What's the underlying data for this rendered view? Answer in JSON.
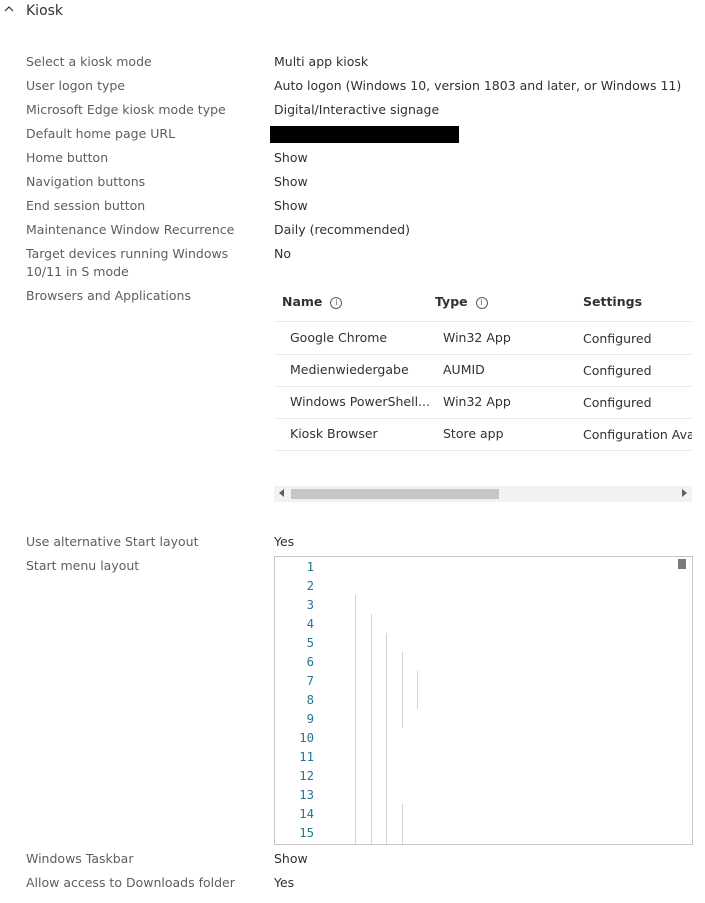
{
  "section": {
    "title": "Kiosk"
  },
  "fields": [
    {
      "label": "Select a kiosk mode",
      "value": "Multi app kiosk"
    },
    {
      "label": "User logon type",
      "value": "Auto logon (Windows 10, version 1803 and later, or Windows 11)"
    },
    {
      "label": "Microsoft Edge kiosk mode type",
      "value": "Digital/Interactive signage"
    },
    {
      "label": "Default home page URL",
      "value": ""
    },
    {
      "label": "Home button",
      "value": "Show"
    },
    {
      "label": "Navigation buttons",
      "value": "Show"
    },
    {
      "label": "End session button",
      "value": "Show"
    },
    {
      "label": "Maintenance Window Recurrence",
      "value": "Daily (recommended)"
    },
    {
      "label": "Target devices running Windows 10/11 in S mode",
      "value": "No"
    },
    {
      "label": "Browsers and Applications",
      "value": ""
    }
  ],
  "apps_table": {
    "headers": {
      "name": "Name",
      "type": "Type",
      "settings": "Settings"
    },
    "rows": [
      {
        "name": "Google Chrome",
        "type": "Win32 App",
        "settings": "Configured"
      },
      {
        "name": "Medienwiedergabe",
        "type": "AUMID",
        "settings": "Configured"
      },
      {
        "name": "Windows PowerShell...",
        "type": "Win32 App",
        "settings": "Configured"
      },
      {
        "name": "Kiosk Browser",
        "type": "Store app",
        "settings": "Configuration Avail"
      }
    ]
  },
  "fields_after": [
    {
      "label": "Use alternative Start layout",
      "value": "Yes"
    },
    {
      "label": "Start menu layout",
      "value": ""
    }
  ],
  "editor": {
    "line_numbers": [
      "1",
      "2",
      "3",
      "4",
      "5",
      "6",
      "7",
      "8",
      "9",
      "10",
      "11",
      "12",
      "13",
      "14",
      "15"
    ]
  },
  "fields_bottom": [
    {
      "label": "Windows Taskbar",
      "value": "Show"
    },
    {
      "label": "Allow access to Downloads folder",
      "value": "Yes"
    }
  ]
}
